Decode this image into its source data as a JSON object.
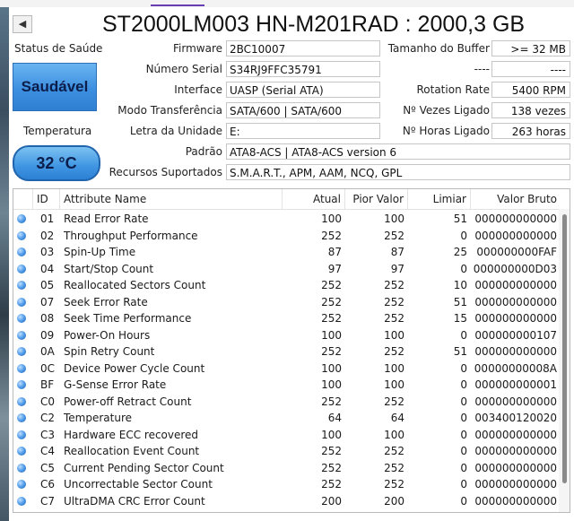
{
  "app": {
    "title": "ST2000LM003 HN-M201RAD : 2000,3 GB",
    "back_icon": "triangle-left-icon"
  },
  "status": {
    "health_label": "Status de Saúde",
    "health_value": "Saudável",
    "health_color": "#3d8fe0",
    "temp_label": "Temperatura",
    "temp_value": "32 °C"
  },
  "fields": {
    "firmware": {
      "label": "Firmware",
      "value": "2BC10007"
    },
    "serial": {
      "label": "Número Serial",
      "value": "S34RJ9FFC35791"
    },
    "interface": {
      "label": "Interface",
      "value": "UASP (Serial ATA)"
    },
    "transfer": {
      "label": "Modo Transferência",
      "value": "SATA/600 | SATA/600"
    },
    "drive_letter": {
      "label": "Letra da Unidade",
      "value": "E:"
    },
    "standard": {
      "label": "Padrão",
      "value": "ATA8-ACS | ATA8-ACS version 6"
    },
    "features": {
      "label": "Recursos Suportados",
      "value": "S.M.A.R.T., APM, AAM, NCQ, GPL"
    },
    "buffer": {
      "label": "Tamanho do Buffer",
      "value": ">= 32 MB"
    },
    "blank1": {
      "label": "----",
      "value": "----"
    },
    "rotation": {
      "label": "Rotation Rate",
      "value": "5400 RPM"
    },
    "power_count": {
      "label": "Nº Vezes Ligado",
      "value": "138 vezes"
    },
    "power_hours": {
      "label": "Nº Horas Ligado",
      "value": "263 horas"
    }
  },
  "table": {
    "headers": [
      "ID",
      "Attribute Name",
      "Atual",
      "Pior Valor",
      "Limiar",
      "Valor Bruto"
    ],
    "rows": [
      [
        "01",
        "Read Error Rate",
        "100",
        "100",
        "51",
        "000000000000"
      ],
      [
        "02",
        "Throughput Performance",
        "252",
        "252",
        "0",
        "000000000000"
      ],
      [
        "03",
        "Spin-Up Time",
        "87",
        "87",
        "25",
        "000000000FAF"
      ],
      [
        "04",
        "Start/Stop Count",
        "97",
        "97",
        "0",
        "000000000D03"
      ],
      [
        "05",
        "Reallocated Sectors Count",
        "252",
        "252",
        "10",
        "000000000000"
      ],
      [
        "07",
        "Seek Error Rate",
        "252",
        "252",
        "51",
        "000000000000"
      ],
      [
        "08",
        "Seek Time Performance",
        "252",
        "252",
        "15",
        "000000000000"
      ],
      [
        "09",
        "Power-On Hours",
        "100",
        "100",
        "0",
        "000000000107"
      ],
      [
        "0A",
        "Spin Retry Count",
        "252",
        "252",
        "51",
        "000000000000"
      ],
      [
        "0C",
        "Device Power Cycle Count",
        "100",
        "100",
        "0",
        "00000000008A"
      ],
      [
        "BF",
        "G-Sense Error Rate",
        "100",
        "100",
        "0",
        "000000000001"
      ],
      [
        "C0",
        "Power-off Retract Count",
        "252",
        "252",
        "0",
        "000000000000"
      ],
      [
        "C2",
        "Temperature",
        "64",
        "64",
        "0",
        "003400120020"
      ],
      [
        "C3",
        "Hardware ECC recovered",
        "100",
        "100",
        "0",
        "000000000000"
      ],
      [
        "C4",
        "Reallocation Event Count",
        "252",
        "252",
        "0",
        "000000000000"
      ],
      [
        "C5",
        "Current Pending Sector Count",
        "252",
        "252",
        "0",
        "000000000000"
      ],
      [
        "C6",
        "Uncorrectable Sector Count",
        "252",
        "252",
        "0",
        "000000000000"
      ],
      [
        "C7",
        "UltraDMA CRC Error Count",
        "200",
        "200",
        "0",
        "000000000000"
      ]
    ]
  }
}
